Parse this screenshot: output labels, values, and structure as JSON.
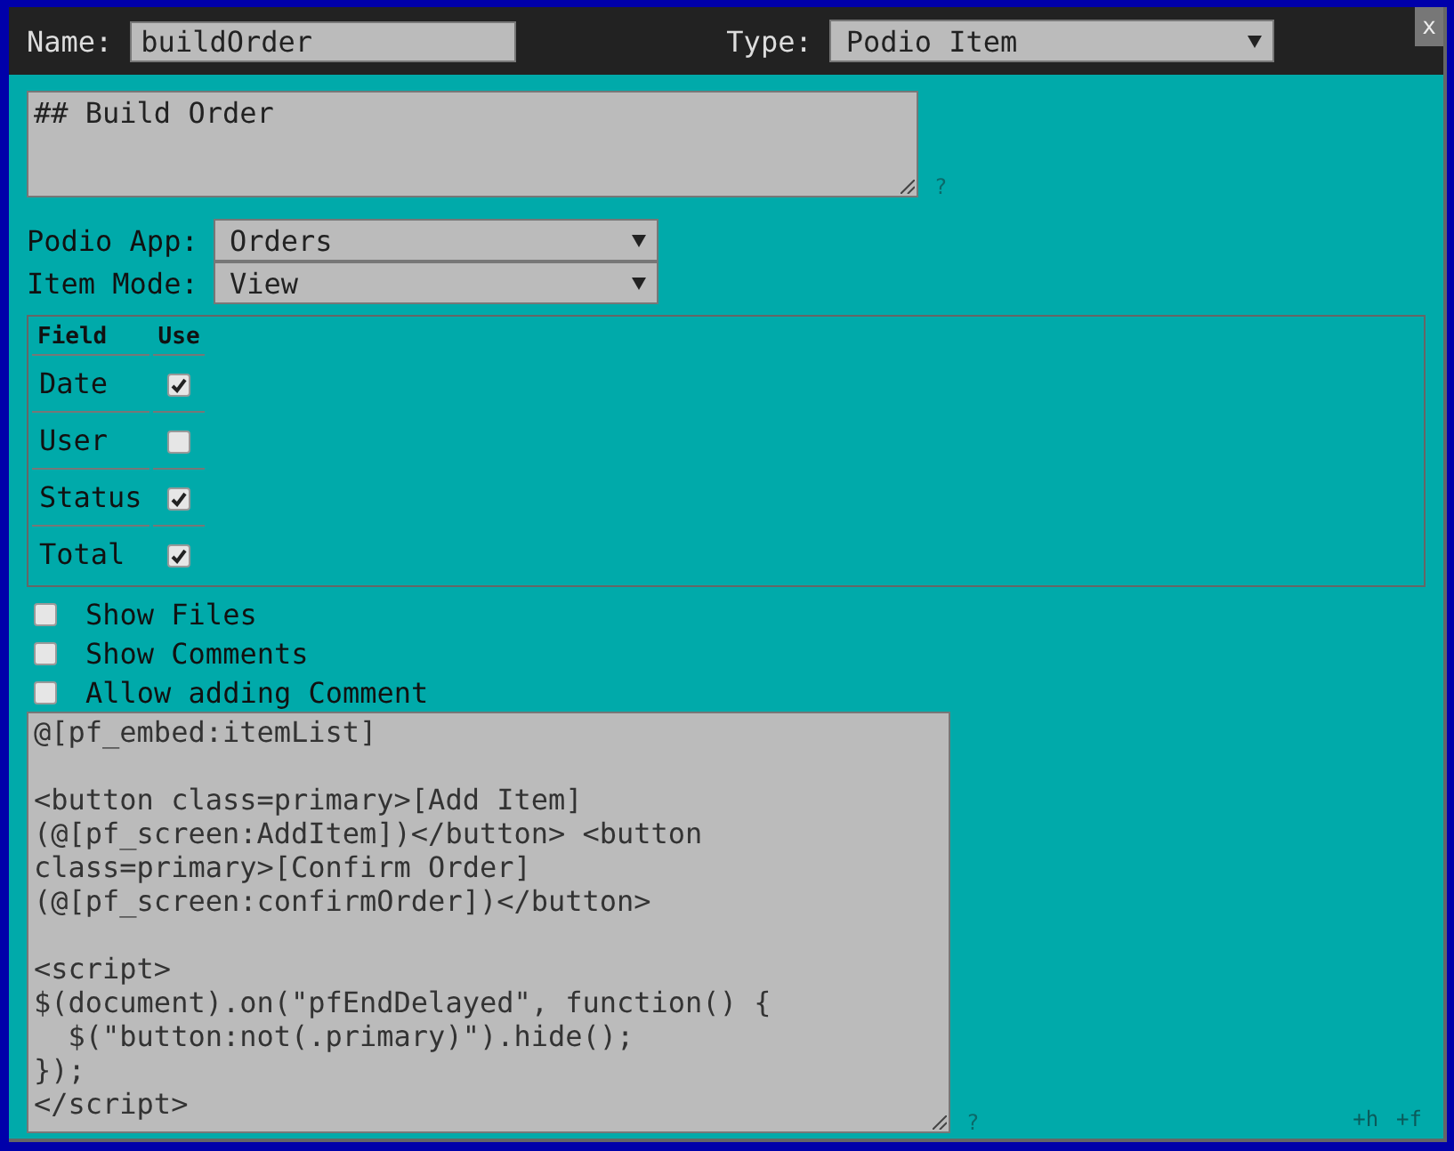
{
  "header": {
    "name_label": "Name:",
    "name_value": "buildOrder",
    "type_label": "Type:",
    "type_value": "Podio Item",
    "close": "x"
  },
  "description": {
    "value": "## Build Order",
    "help": "?"
  },
  "podio_app": {
    "label": "Podio App:",
    "value": "Orders"
  },
  "item_mode": {
    "label": "Item Mode:",
    "value": "View"
  },
  "fields_table": {
    "columns": [
      "Field",
      "Use"
    ],
    "rows": [
      {
        "field": "Date",
        "checked": true
      },
      {
        "field": "User",
        "checked": false
      },
      {
        "field": "Status",
        "checked": true
      },
      {
        "field": "Total",
        "checked": true
      }
    ]
  },
  "options": [
    {
      "label": "Show Files",
      "checked": false
    },
    {
      "label": "Show Comments",
      "checked": false
    },
    {
      "label": "Allow adding Comment",
      "checked": false
    }
  ],
  "code": {
    "value": "@[pf_embed:itemList]\n\n<button class=primary>[Add Item](@[pf_screen:AddItem])</button> <button class=primary>[Confirm Order](@[pf_screen:confirmOrder])</button>\n\n<script>\n$(document).on(\"pfEndDelayed\", function() {\n  $(\"button:not(.primary)\").hide();\n});\n</script>",
    "help": "?"
  },
  "footer_links": [
    "+h",
    "+f"
  ]
}
